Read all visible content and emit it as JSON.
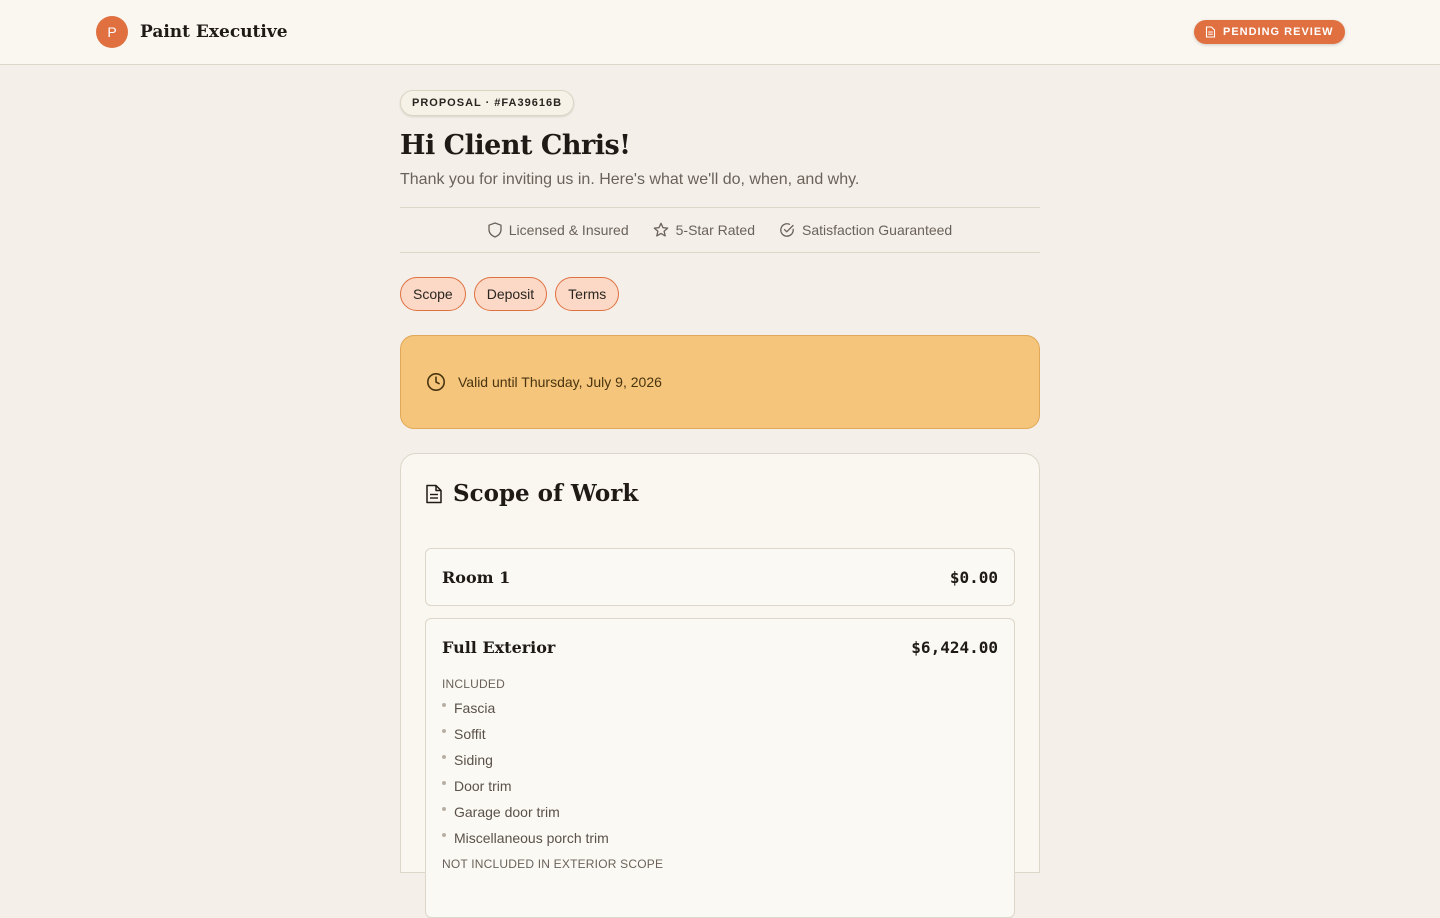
{
  "header": {
    "brand_initial": "P",
    "brand_name": "Paint Executive",
    "status": "PENDING REVIEW"
  },
  "proposal": {
    "badge": "PROPOSAL · #FA39616B",
    "greeting": "Hi Client Chris!",
    "subtitle": "Thank you for inviting us in. Here's what we'll do, when, and why."
  },
  "trust": {
    "items": [
      {
        "label": "Licensed & Insured",
        "icon": "shield-icon"
      },
      {
        "label": "5-Star Rated",
        "icon": "star-icon"
      },
      {
        "label": "Satisfaction Guaranteed",
        "icon": "check-circle-icon"
      }
    ]
  },
  "tabs": [
    "Scope",
    "Deposit",
    "Terms"
  ],
  "validity": {
    "text": "Valid until Thursday, July 9, 2026",
    "icon": "clock-icon"
  },
  "scope": {
    "title": "Scope of Work",
    "icon": "document-icon",
    "rooms": [
      {
        "name": "Room 1",
        "price": "$0.00"
      },
      {
        "name": "Full Exterior",
        "price": "$6,424.00",
        "included_label": "INCLUDED",
        "included": [
          "Fascia",
          "Soffit",
          "Siding",
          "Door trim",
          "Garage door trim",
          "Miscellaneous porch trim"
        ],
        "excluded_label": "NOT INCLUDED IN EXTERIOR SCOPE"
      }
    ]
  },
  "colors": {
    "accent": "#e07040",
    "validity_bg": "#f4c57a",
    "page_bg": "#f4f0e9"
  }
}
